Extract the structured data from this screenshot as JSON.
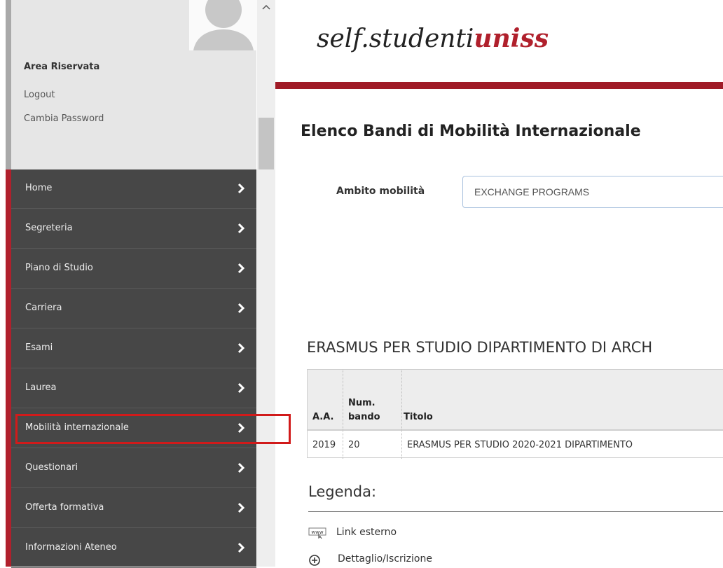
{
  "sidebar": {
    "user": {
      "title": "Area Riservata",
      "logout": "Logout",
      "change_password": "Cambia Password"
    },
    "menu": [
      {
        "label": "Home"
      },
      {
        "label": "Segreteria"
      },
      {
        "label": "Piano di Studio"
      },
      {
        "label": "Carriera"
      },
      {
        "label": "Esami"
      },
      {
        "label": "Laurea"
      },
      {
        "label": "Mobilità internazionale"
      },
      {
        "label": "Questionari"
      },
      {
        "label": "Offerta formativa"
      },
      {
        "label": "Informazioni Ateneo"
      }
    ]
  },
  "header": {
    "brand_part1": "self.studenti",
    "brand_part2": "uniss"
  },
  "main": {
    "page_title": "Elenco Bandi di Mobilità Internazionale",
    "filter": {
      "label": "Ambito mobilità",
      "value": "EXCHANGE PROGRAMS"
    },
    "section_heading": "ERASMUS PER STUDIO DIPARTIMENTO DI ARCH",
    "table": {
      "headers": {
        "aa": "A.A.",
        "num_line1": "Num.",
        "num_line2": "bando",
        "titolo": "Titolo"
      },
      "rows": [
        {
          "aa": "2019",
          "num": "20",
          "titolo": "ERASMUS PER STUDIO 2020-2021 DIPARTIMENTO"
        }
      ]
    },
    "legend": {
      "title": "Legenda:",
      "items": [
        {
          "icon": "www-link-icon",
          "label": "Link esterno"
        },
        {
          "icon": "plus-circle-icon",
          "label": "Dettaglio/Iscrizione"
        }
      ]
    }
  },
  "colors": {
    "accent_red": "#b0202c",
    "menu_bg": "#474747",
    "highlight": "#d11a1a"
  }
}
